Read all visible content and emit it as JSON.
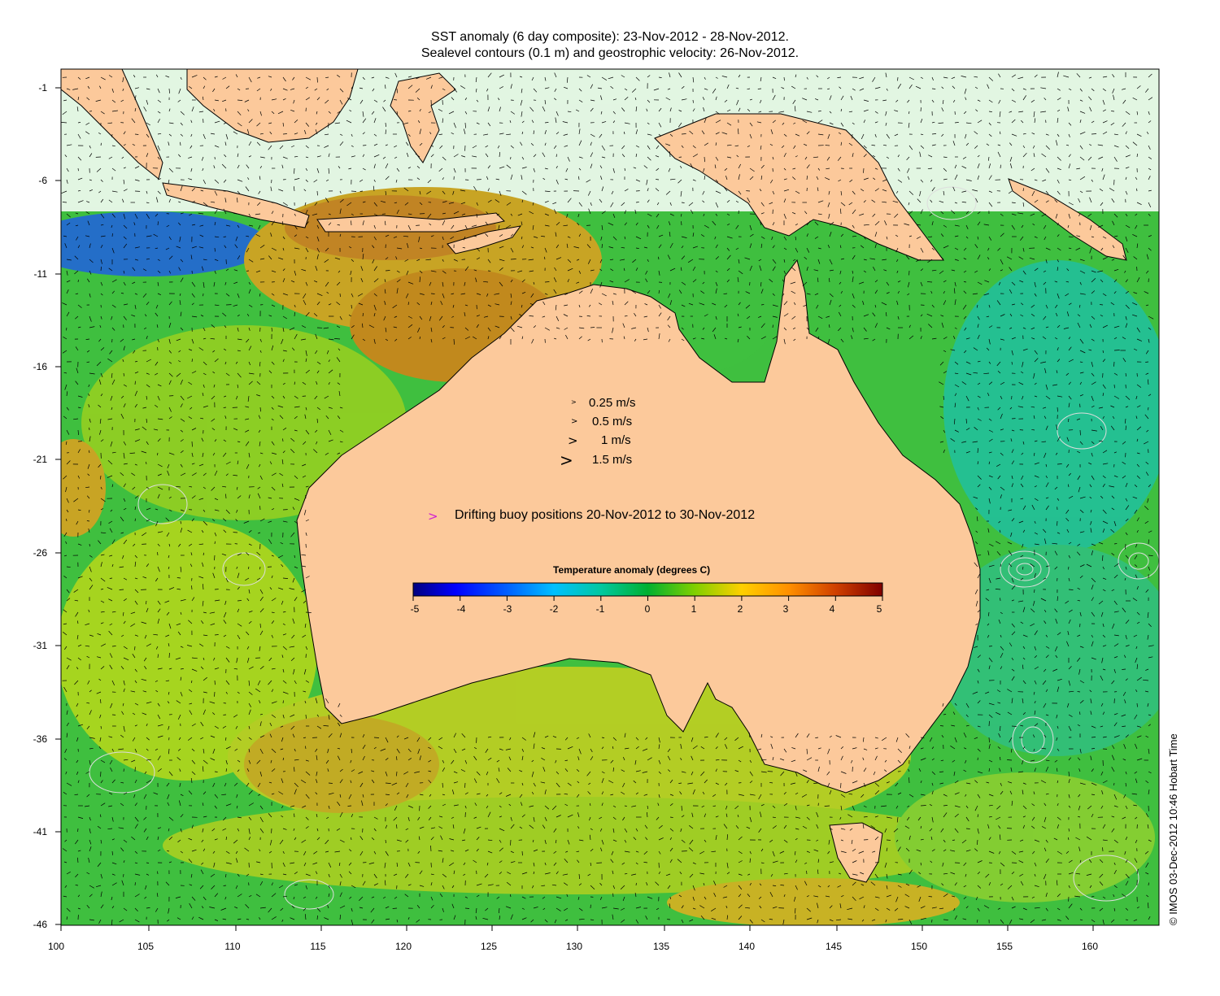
{
  "title_line1": "SST anomaly (6 day composite): 23-Nov-2012 - 28-Nov-2012.",
  "title_line2": "Sealevel contours (0.1 m) and geostrophic velocity: 26-Nov-2012.",
  "y_axis_ticks": [
    "-1",
    "-6",
    "-11",
    "-16",
    "-21",
    "-26",
    "-31",
    "-36",
    "-41",
    "-46"
  ],
  "x_axis_ticks": [
    "100",
    "105",
    "110",
    "115",
    "120",
    "125",
    "130",
    "135",
    "140",
    "145",
    "150",
    "155",
    "160"
  ],
  "velocity_legend": [
    {
      "speed": 0.25,
      "label": "0.25 m/s"
    },
    {
      "speed": 0.5,
      "label": "0.5 m/s"
    },
    {
      "speed": 1,
      "label": "1 m/s"
    },
    {
      "speed": 1.5,
      "label": "1.5 m/s"
    }
  ],
  "buoy_legend": {
    "symbol": ">",
    "label": "Drifting buoy positions 20-Nov-2012 to 30-Nov-2012",
    "color": "#d020d0"
  },
  "colorbar": {
    "label": "Temperature anomaly (degrees C)",
    "min": -5,
    "max": 5,
    "ticks": [
      "-5",
      "-4",
      "-3",
      "-2",
      "-1",
      "0",
      "1",
      "2",
      "3",
      "4",
      "5"
    ],
    "colors": [
      "#00007f",
      "#0000ff",
      "#007fff",
      "#00c8ff",
      "#00c8a0",
      "#00b050",
      "#40c020",
      "#c8e000",
      "#ffd000",
      "#ff9000",
      "#e05000",
      "#900000"
    ]
  },
  "credit": "© IMOS 03-Dec-2012 10:46 Hobart Time",
  "colors": {
    "land": "#fcc99b",
    "ocean_base": "#3fbf3f",
    "warm": "#e8a020",
    "cool": "#20c0a0",
    "contour": "#dddddd"
  }
}
